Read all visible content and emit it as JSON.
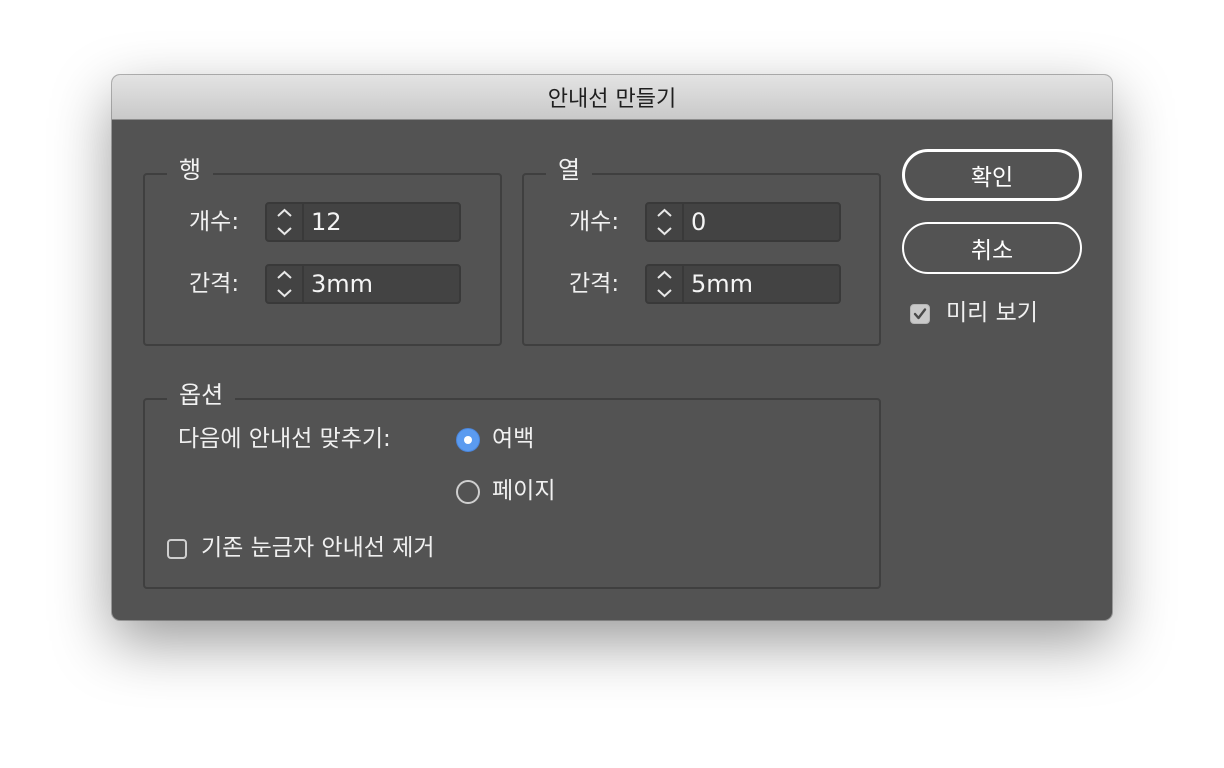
{
  "dialog": {
    "title": "안내선 만들기"
  },
  "rows": {
    "legend": "행",
    "count_label": "개수:",
    "count_value": "12",
    "gutter_label": "간격:",
    "gutter_value": "3mm"
  },
  "columns": {
    "legend": "열",
    "count_label": "개수:",
    "count_value": "0",
    "gutter_label": "간격:",
    "gutter_value": "5mm"
  },
  "buttons": {
    "ok": "확인",
    "cancel": "취소"
  },
  "preview": {
    "label": "미리 보기",
    "checked": true
  },
  "options": {
    "legend": "옵션",
    "fit_label": "다음에 안내선 맞추기:",
    "fit_choices": [
      {
        "label": "여백",
        "selected": true
      },
      {
        "label": "페이지",
        "selected": false
      }
    ],
    "remove_existing_label": "기존 눈금자 안내선 제거",
    "remove_existing_checked": false
  },
  "colors": {
    "dialog_bg": "#535353",
    "accent": "#5b9bf0",
    "field_bg": "#434343",
    "text": "#f0f0f0"
  },
  "icons": {
    "stepper": "up-down-chevron-icon",
    "check": "checkmark-icon"
  }
}
